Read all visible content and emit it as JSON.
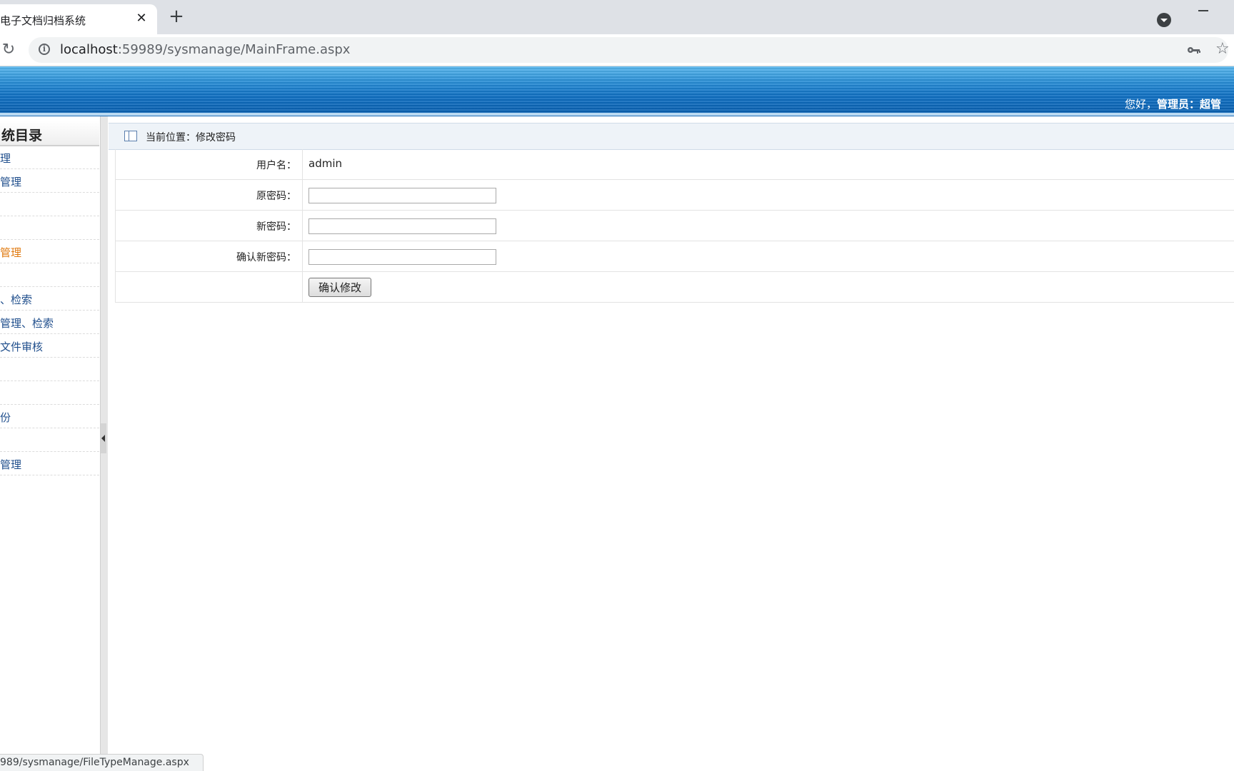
{
  "browser": {
    "tab_title": "电子文档归档系统",
    "close_glyph": "✕",
    "new_tab_glyph": "+",
    "url_host": "localhost",
    "url_rest": ":59989/sysmanage/MainFrame.aspx",
    "status_url": "989/sysmanage/FileTypeManage.aspx"
  },
  "header": {
    "greeting_prefix": "您好，",
    "greeting_user": "管理员：超管"
  },
  "sidebar": {
    "title": "统目录",
    "items": [
      {
        "label": "理",
        "active": false
      },
      {
        "label": "管理",
        "active": false
      },
      {
        "label": "",
        "active": false
      },
      {
        "label": "",
        "active": false
      },
      {
        "label": "管理",
        "active": true
      },
      {
        "label": "",
        "active": false
      },
      {
        "label": "、检索",
        "active": false
      },
      {
        "label": "管理、检索",
        "active": false
      },
      {
        "label": "文件审核",
        "active": false
      },
      {
        "label": "",
        "active": false
      },
      {
        "label": "",
        "active": false
      },
      {
        "label": "份",
        "active": false
      },
      {
        "label": "",
        "active": false
      },
      {
        "label": "管理",
        "active": false
      }
    ]
  },
  "breadcrumb": {
    "text": "当前位置：修改密码"
  },
  "form": {
    "username_label": "用户名：",
    "username_value": "admin",
    "old_password_label": "原密码：",
    "old_password_value": "",
    "new_password_label": "新密码：",
    "new_password_value": "",
    "confirm_password_label": "确认新密码：",
    "confirm_password_value": "",
    "submit_label": "确认修改"
  },
  "colors": {
    "header_blue": "#0f6fc2",
    "link_blue": "#1f4e8c",
    "active_orange": "#e07a10"
  }
}
